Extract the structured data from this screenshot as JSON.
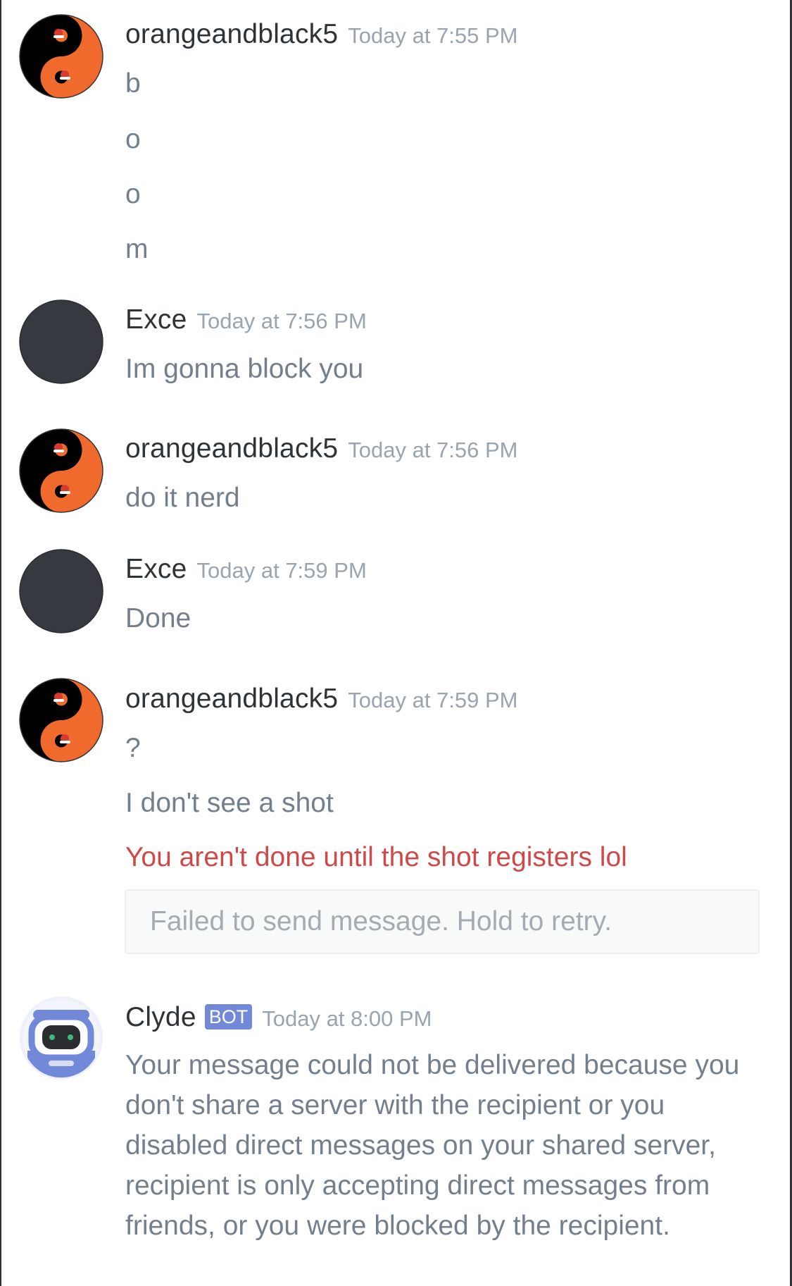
{
  "messages": [
    {
      "author": "orangeandblack5",
      "timestamp": "Today at 7:55 PM",
      "avatar_icon": "yin-yang-santa-hat-icon",
      "lines": [
        "b",
        "o",
        "o",
        "m"
      ]
    },
    {
      "author": "Exce",
      "timestamp": "Today at 7:56 PM",
      "avatar_icon": "default-dark-avatar",
      "lines": [
        "Im gonna block you"
      ]
    },
    {
      "author": "orangeandblack5",
      "timestamp": "Today at 7:56 PM",
      "avatar_icon": "yin-yang-santa-hat-icon",
      "lines": [
        "do it nerd"
      ]
    },
    {
      "author": "Exce",
      "timestamp": "Today at 7:59 PM",
      "avatar_icon": "default-dark-avatar",
      "lines": [
        "Done"
      ]
    },
    {
      "author": "orangeandblack5",
      "timestamp": "Today at 7:59 PM",
      "avatar_icon": "yin-yang-santa-hat-icon",
      "lines": [
        "?",
        "I don't see a shot"
      ],
      "failed_line": "You aren't done until the shot registers lol",
      "failed_notice": "Failed to send message. Hold to retry."
    },
    {
      "author": "Clyde",
      "bot_tag": "BOT",
      "timestamp": "Today at 8:00 PM",
      "avatar_icon": "clyde-robot-icon",
      "text": "Your message could not be delivered because you don't share a server with the recipient or you disabled direct messages on your shared server, recipient is only accepting direct messages from friends, or you were blocked by the recipient."
    }
  ],
  "colors": {
    "username": "#2e3338",
    "timestamp": "#99a4ae",
    "message_text": "#747f8d",
    "error_text": "#d04949",
    "bot_tag": "#7289da",
    "avatar_orange": "#ef6a2c",
    "avatar_black": "#000000",
    "avatar_dark": "#36393f"
  }
}
